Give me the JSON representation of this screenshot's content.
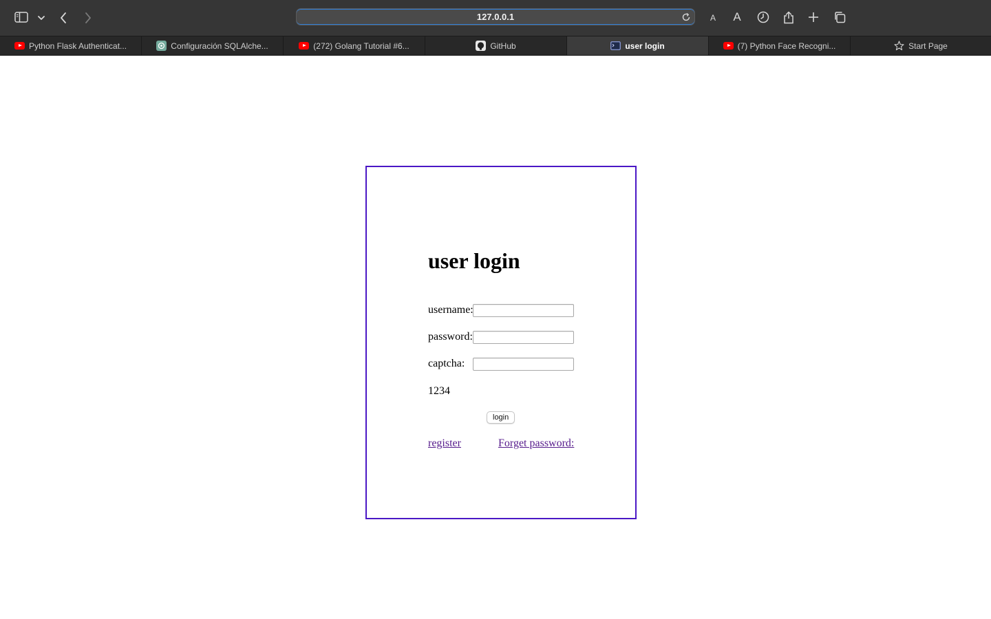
{
  "browser": {
    "url": "127.0.0.1",
    "font_small_label": "A",
    "font_large_label": "A",
    "tabs": [
      {
        "label": "Python Flask Authenticat...",
        "favicon": "youtube-icon",
        "active": false
      },
      {
        "label": "Configuración SQLAlche...",
        "favicon": "chatgpt-icon",
        "active": false
      },
      {
        "label": "(272) Golang Tutorial #6...",
        "favicon": "youtube-icon",
        "active": false
      },
      {
        "label": "GitHub",
        "favicon": "github-icon",
        "active": false
      },
      {
        "label": "user login",
        "favicon": "terminal-icon",
        "active": true
      },
      {
        "label": "(7) Python Face Recogni...",
        "favicon": "youtube-icon",
        "active": false
      },
      {
        "label": "Start Page",
        "favicon": "star-icon",
        "active": false
      }
    ]
  },
  "login": {
    "title": "user login",
    "username_label": "username:",
    "password_label": "password:",
    "captcha_label": "captcha:",
    "captcha_code": "1234",
    "login_button": "login",
    "register_link": "register",
    "forget_link": "Forget password:"
  },
  "colors": {
    "box_border": "#4a17c5",
    "visited_link": "#551a8b",
    "toolbar_bg": "#363636"
  }
}
